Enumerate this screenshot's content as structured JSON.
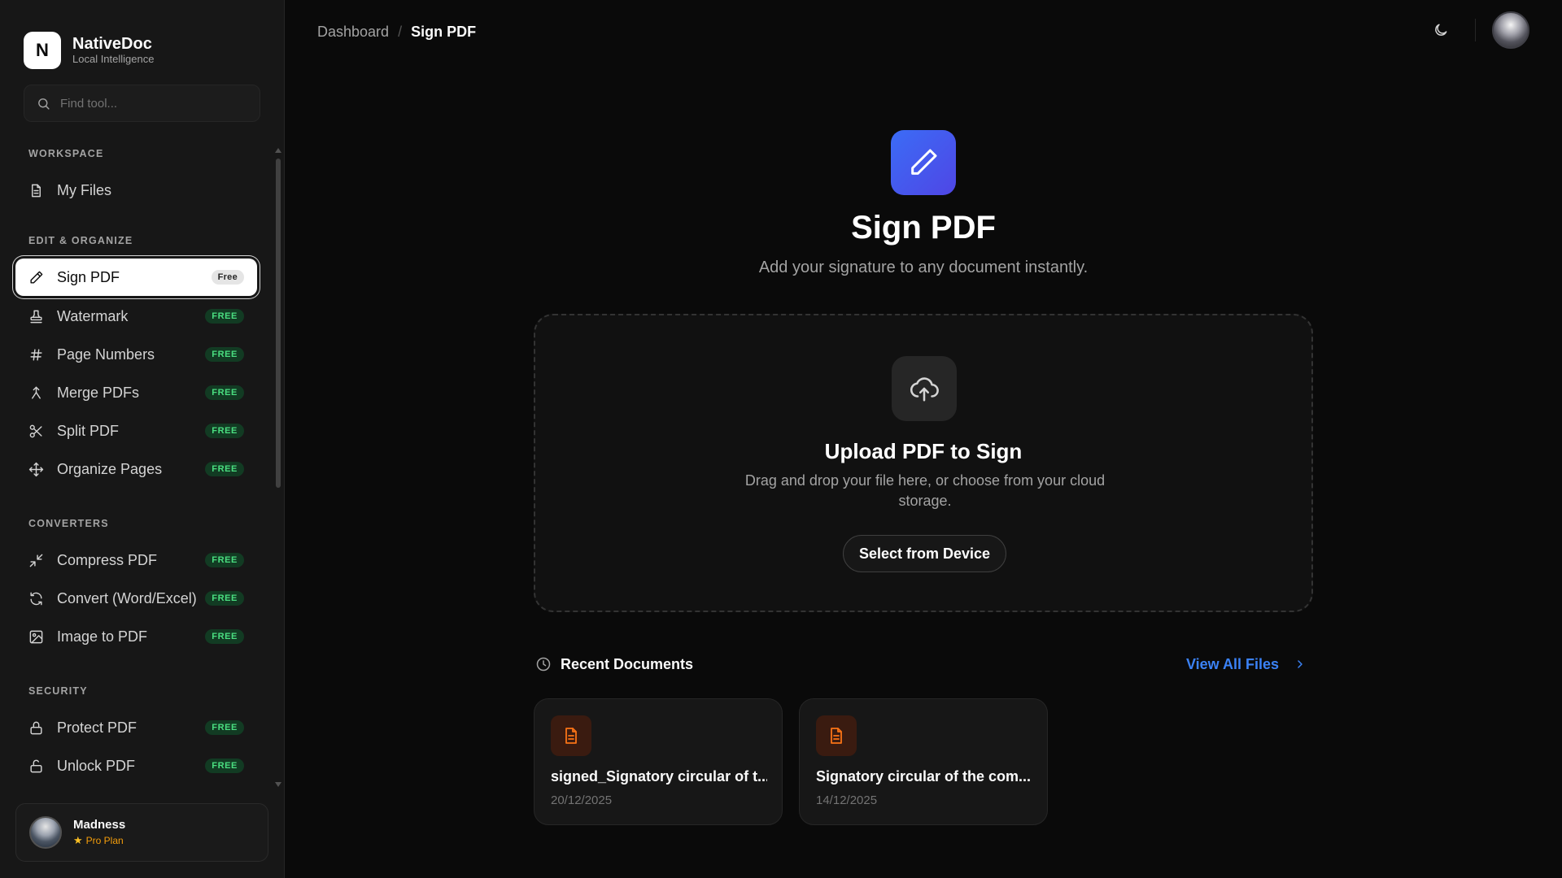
{
  "brand": {
    "logo_letter": "N",
    "name": "NativeDoc",
    "subtitle": "Local Intelligence"
  },
  "search": {
    "placeholder": "Find tool...",
    "value": ""
  },
  "sidebar": {
    "sections": [
      {
        "title": "WORKSPACE",
        "items": [
          {
            "label": "My Files",
            "icon": "file-icon"
          }
        ]
      },
      {
        "title": "EDIT & ORGANIZE",
        "items": [
          {
            "label": "Sign PDF",
            "badge": "Free",
            "icon": "pen-icon",
            "active": true
          },
          {
            "label": "Watermark",
            "badge": "FREE",
            "icon": "stamp-icon"
          },
          {
            "label": "Page Numbers",
            "badge": "FREE",
            "icon": "hash-icon"
          },
          {
            "label": "Merge PDFs",
            "badge": "FREE",
            "icon": "merge-icon"
          },
          {
            "label": "Split PDF",
            "badge": "FREE",
            "icon": "scissors-icon"
          },
          {
            "label": "Organize Pages",
            "badge": "FREE",
            "icon": "move-icon"
          }
        ]
      },
      {
        "title": "CONVERTERS",
        "items": [
          {
            "label": "Compress PDF",
            "badge": "FREE",
            "icon": "compress-icon"
          },
          {
            "label": "Convert (Word/Excel)",
            "badge": "FREE",
            "icon": "refresh-icon"
          },
          {
            "label": "Image to PDF",
            "badge": "FREE",
            "icon": "image-icon"
          }
        ]
      },
      {
        "title": "SECURITY",
        "items": [
          {
            "label": "Protect PDF",
            "badge": "FREE",
            "icon": "lock-icon"
          },
          {
            "label": "Unlock PDF",
            "badge": "FREE",
            "icon": "unlock-icon"
          }
        ]
      }
    ]
  },
  "user": {
    "name": "Madness",
    "plan": "Pro Plan"
  },
  "breadcrumb": {
    "parent": "Dashboard",
    "separator": "/",
    "current": "Sign PDF"
  },
  "hero": {
    "title": "Sign PDF",
    "subtitle": "Add your signature to any document instantly."
  },
  "upload": {
    "title": "Upload PDF to Sign",
    "description": "Drag and drop your file here, or choose from your cloud storage.",
    "button": "Select from Device"
  },
  "recent": {
    "title": "Recent Documents",
    "view_all": "View All Files",
    "documents": [
      {
        "name": "signed_Signatory circular of t...",
        "date": "20/12/2025"
      },
      {
        "name": "Signatory circular of the com...",
        "date": "14/12/2025"
      }
    ]
  },
  "colors": {
    "accent": "#3b82f6",
    "hero_gradient_start": "#3b6cf6",
    "hero_gradient_end": "#4f46e5",
    "badge_text": "#4ade80",
    "doc_icon": "#f97316",
    "plan_star": "#fbbf24"
  }
}
